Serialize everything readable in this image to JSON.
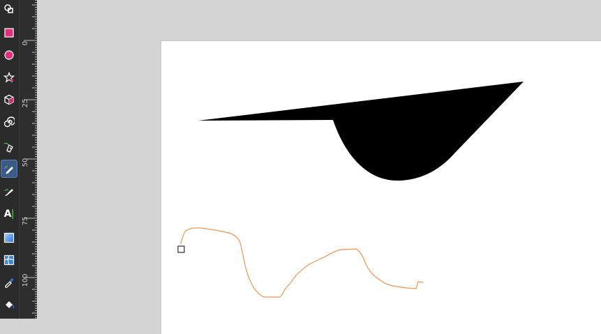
{
  "toolbar": {
    "tools": [
      {
        "name": "shape-builder-tool",
        "icon": "shape-builder-icon"
      },
      {
        "name": "rectangle-tool",
        "icon": "rectangle-icon"
      },
      {
        "name": "ellipse-tool",
        "icon": "ellipse-icon"
      },
      {
        "name": "star-tool",
        "icon": "star-icon"
      },
      {
        "name": "3d-box-tool",
        "icon": "3d-box-icon"
      },
      {
        "name": "spiral-tool",
        "icon": "spiral-icon"
      },
      {
        "name": "pen-tool",
        "icon": "pen-icon"
      },
      {
        "name": "pencil-tool",
        "icon": "pencil-icon",
        "active": true
      },
      {
        "name": "calligraphy-tool",
        "icon": "calligraphy-icon"
      },
      {
        "name": "text-tool",
        "icon": "text-icon",
        "label": "A"
      },
      {
        "name": "gradient-tool",
        "icon": "gradient-icon"
      },
      {
        "name": "mesh-tool",
        "icon": "mesh-icon"
      },
      {
        "name": "dropper-tool",
        "icon": "dropper-icon"
      },
      {
        "name": "paint-bucket-tool",
        "icon": "paint-bucket-icon"
      }
    ]
  },
  "ruler": {
    "labels": [
      "0",
      "25",
      "50",
      "75",
      "100"
    ]
  },
  "colors": {
    "toolbar_bg": "#2b2b2b",
    "active_tool_bg": "#3b5a86",
    "canvas_bg": "#d4d4d4",
    "page_bg": "#ffffff",
    "shape_fill": "#000000",
    "pencil_stroke": "#e8955a",
    "rect_tool_color": "#e0307a"
  }
}
